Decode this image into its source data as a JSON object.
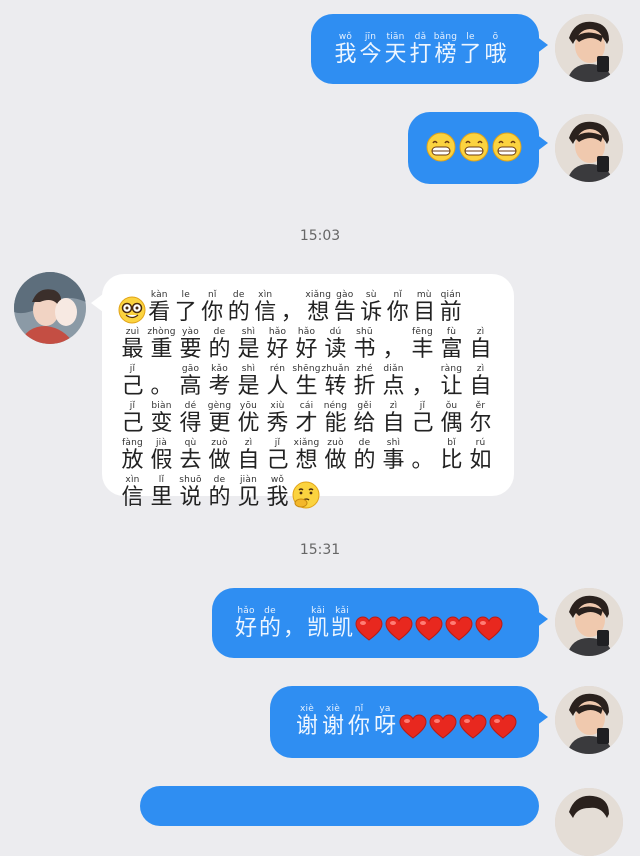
{
  "colors": {
    "outgoing_bubble": "#2f8ef2",
    "incoming_bubble": "#ffffff",
    "background": "#ececef",
    "heart": "#e8281f"
  },
  "messages": {
    "m1": {
      "words": [
        {
          "py": "wǒ",
          "hz": "我"
        },
        {
          "py": "jīn",
          "hz": "今"
        },
        {
          "py": "tiān",
          "hz": "天"
        },
        {
          "py": "dǎ",
          "hz": "打"
        },
        {
          "py": "bǎng",
          "hz": "榜"
        },
        {
          "py": "le",
          "hz": "了"
        },
        {
          "py": "ō",
          "hz": "哦"
        }
      ]
    },
    "m2": {
      "emoji": [
        "grin-emoji",
        "grin-emoji",
        "grin-emoji"
      ]
    },
    "timestamp1": "15:03",
    "m3": {
      "lines": [
        [
          {
            "py": "kàn",
            "hz": "看"
          },
          {
            "py": "le",
            "hz": "了"
          },
          {
            "py": "nǐ",
            "hz": "你"
          },
          {
            "py": "de",
            "hz": "的"
          },
          {
            "py": "xìn",
            "hz": "信"
          },
          {
            "py": "",
            "hz": "，"
          },
          {
            "py": "xiǎng",
            "hz": "想"
          },
          {
            "py": "gào",
            "hz": "告"
          },
          {
            "py": "sù",
            "hz": "诉"
          },
          {
            "py": "nǐ",
            "hz": "你"
          },
          {
            "py": "mù",
            "hz": "目"
          },
          {
            "py": "qián",
            "hz": "前"
          }
        ],
        [
          {
            "py": "zuì",
            "hz": "最"
          },
          {
            "py": "zhòng",
            "hz": "重"
          },
          {
            "py": "yào",
            "hz": "要"
          },
          {
            "py": "de",
            "hz": "的"
          },
          {
            "py": "shì",
            "hz": "是"
          },
          {
            "py": "hǎo",
            "hz": "好"
          },
          {
            "py": "hǎo",
            "hz": "好"
          },
          {
            "py": "dú",
            "hz": "读"
          },
          {
            "py": "shū",
            "hz": "书"
          },
          {
            "py": "",
            "hz": "，"
          },
          {
            "py": "fēng",
            "hz": "丰"
          },
          {
            "py": "fù",
            "hz": "富"
          },
          {
            "py": "zì",
            "hz": "自"
          }
        ],
        [
          {
            "py": "jǐ",
            "hz": "己"
          },
          {
            "py": "",
            "hz": "。"
          },
          {
            "py": "gāo",
            "hz": "高"
          },
          {
            "py": "kǎo",
            "hz": "考"
          },
          {
            "py": "shì",
            "hz": "是"
          },
          {
            "py": "rén",
            "hz": "人"
          },
          {
            "py": "shēng",
            "hz": "生"
          },
          {
            "py": "zhuǎn",
            "hz": "转"
          },
          {
            "py": "zhé",
            "hz": "折"
          },
          {
            "py": "diǎn",
            "hz": "点"
          },
          {
            "py": "",
            "hz": "，"
          },
          {
            "py": "ràng",
            "hz": "让"
          },
          {
            "py": "zì",
            "hz": "自"
          }
        ],
        [
          {
            "py": "jǐ",
            "hz": "己"
          },
          {
            "py": "biàn",
            "hz": "变"
          },
          {
            "py": "dé",
            "hz": "得"
          },
          {
            "py": "gèng",
            "hz": "更"
          },
          {
            "py": "yōu",
            "hz": "优"
          },
          {
            "py": "xiù",
            "hz": "秀"
          },
          {
            "py": "cái",
            "hz": "才"
          },
          {
            "py": "néng",
            "hz": "能"
          },
          {
            "py": "gěi",
            "hz": "给"
          },
          {
            "py": "zì",
            "hz": "自"
          },
          {
            "py": "jǐ",
            "hz": "己"
          },
          {
            "py": "ǒu",
            "hz": "偶"
          },
          {
            "py": "ěr",
            "hz": "尔"
          }
        ],
        [
          {
            "py": "fàng",
            "hz": "放"
          },
          {
            "py": "jià",
            "hz": "假"
          },
          {
            "py": "qù",
            "hz": "去"
          },
          {
            "py": "zuò",
            "hz": "做"
          },
          {
            "py": "zì",
            "hz": "自"
          },
          {
            "py": "jǐ",
            "hz": "己"
          },
          {
            "py": "xiǎng",
            "hz": "想"
          },
          {
            "py": "zuò",
            "hz": "做"
          },
          {
            "py": "de",
            "hz": "的"
          },
          {
            "py": "shì",
            "hz": "事"
          },
          {
            "py": "",
            "hz": "。"
          },
          {
            "py": "bǐ",
            "hz": "比"
          },
          {
            "py": "rú",
            "hz": "如"
          }
        ],
        [
          {
            "py": "xìn",
            "hz": "信"
          },
          {
            "py": "lǐ",
            "hz": "里"
          },
          {
            "py": "shuō",
            "hz": "说"
          },
          {
            "py": "de",
            "hz": "的"
          },
          {
            "py": "jiàn",
            "hz": "见"
          },
          {
            "py": "wǒ",
            "hz": "我"
          }
        ]
      ],
      "lead_emoji": "nerd-emoji",
      "trail_emoji": "thinking-emoji"
    },
    "timestamp2": "15:31",
    "m4": {
      "words": [
        {
          "py": "hǎo",
          "hz": "好"
        },
        {
          "py": "de",
          "hz": "的"
        },
        {
          "py": "",
          "hz": "，"
        },
        {
          "py": "kǎi",
          "hz": "凯"
        },
        {
          "py": "kǎi",
          "hz": "凯"
        }
      ],
      "hearts": 5
    },
    "m5": {
      "words": [
        {
          "py": "xiè",
          "hz": "谢"
        },
        {
          "py": "xiè",
          "hz": "谢"
        },
        {
          "py": "nǐ",
          "hz": "你"
        },
        {
          "py": "ya",
          "hz": "呀"
        }
      ],
      "hearts": 4
    }
  }
}
